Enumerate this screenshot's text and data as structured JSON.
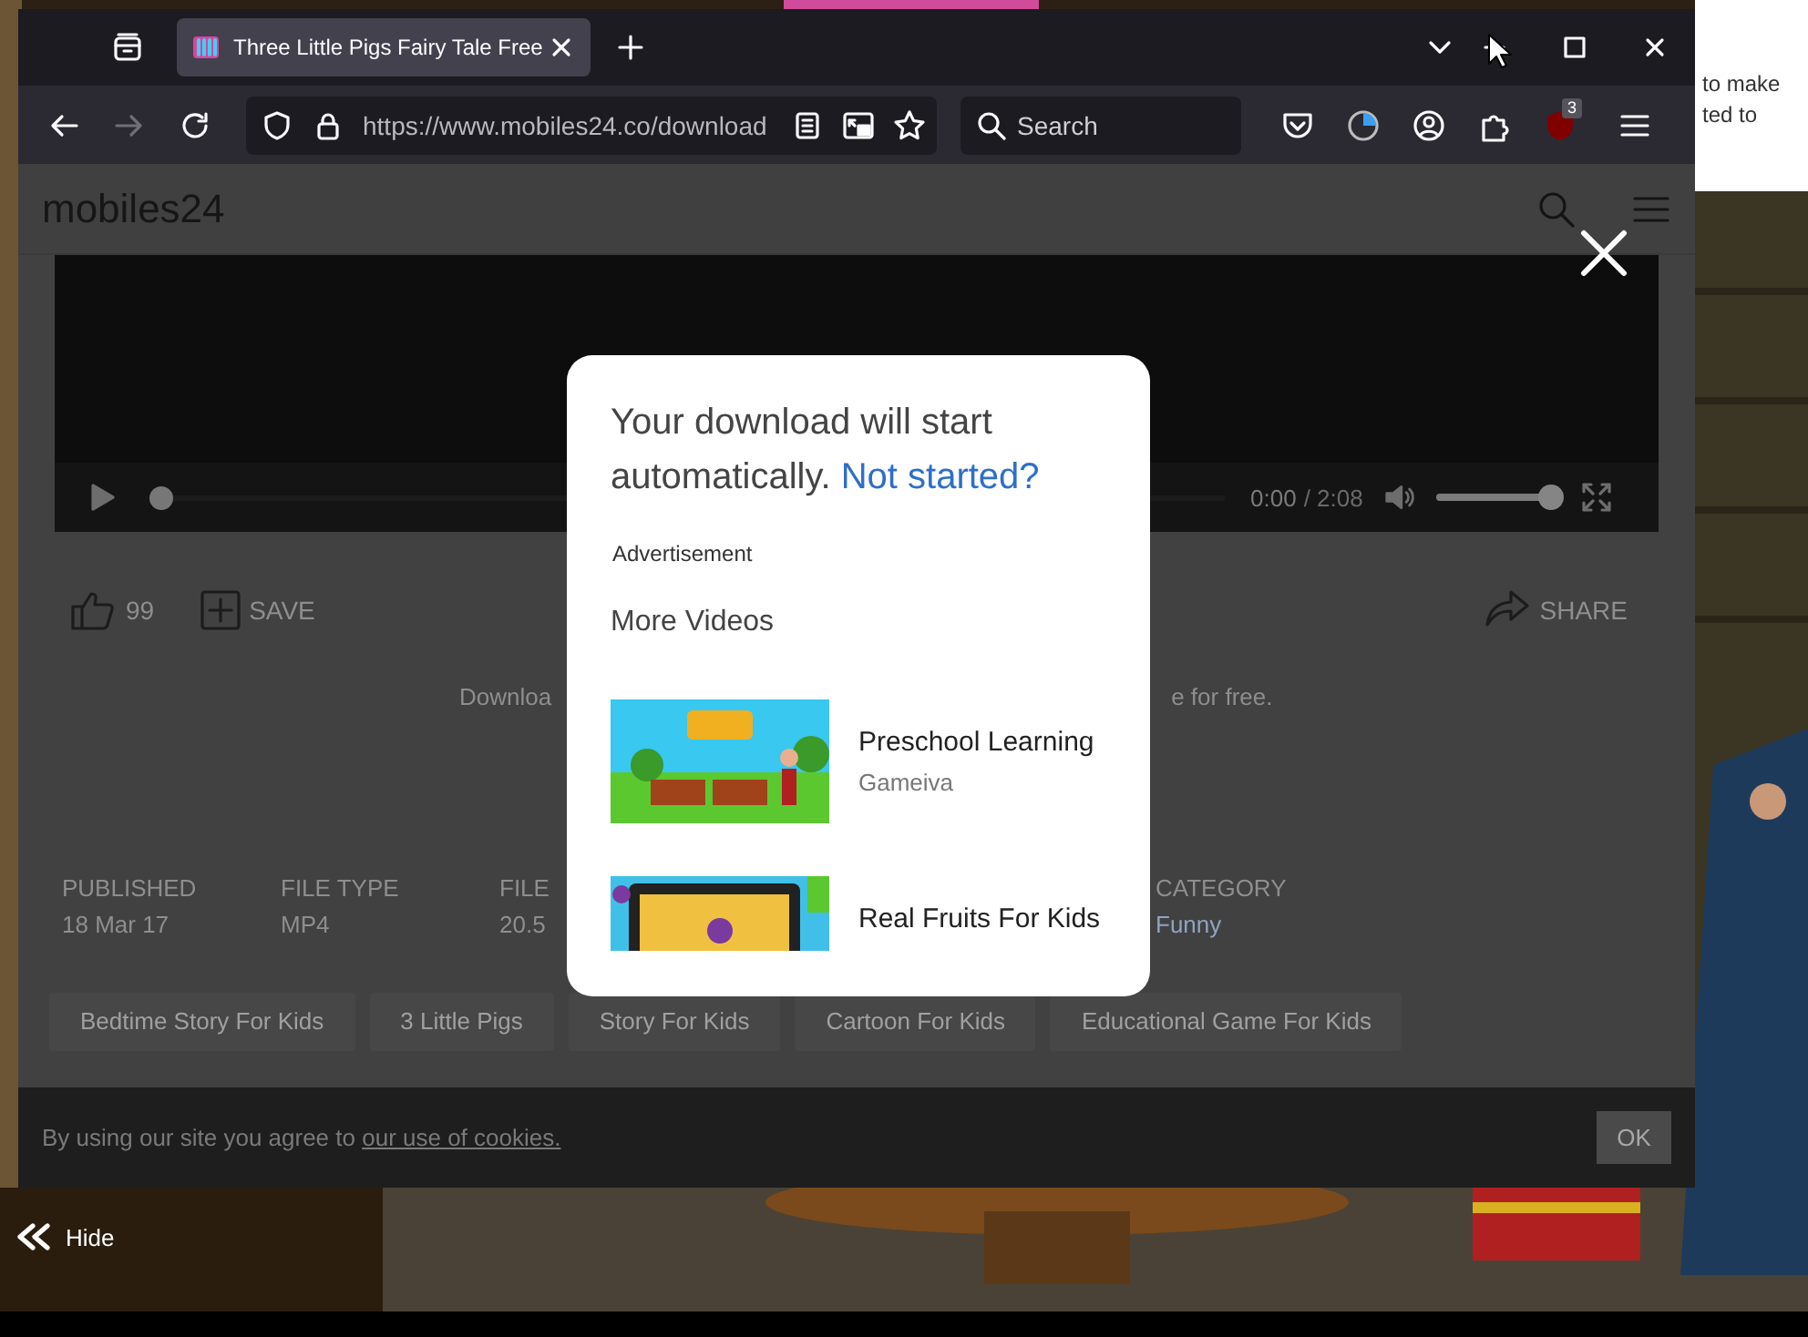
{
  "desktop": {
    "background": {
      "kind": "picture"
    },
    "side_window_lines": [
      "to make",
      "ted to"
    ],
    "hide_button": {
      "label": "Hide"
    }
  },
  "browser": {
    "tabs": [
      {
        "title": "Three Little Pigs Fairy Tale Free",
        "selected": true
      }
    ],
    "forward_disabled": true,
    "url": "https://www.mobiles24.co/download",
    "search": {
      "placeholder": "Search"
    },
    "extension_badge": "3"
  },
  "site": {
    "logo": "mobiles24",
    "player": {
      "time": "0:00",
      "duration": "/ 2:08",
      "progress": {
        "level": 0
      },
      "volume": {
        "level": 0.95
      }
    },
    "likes": "99",
    "save": "SAVE",
    "share": "SHARE",
    "download_text_left": "Downloa",
    "download_text_right": "e for free.",
    "meta_left": [
      {
        "label": "PUBLISHED",
        "value": "18 Mar 17"
      },
      {
        "label": "FILE TYPE",
        "value": "MP4"
      },
      {
        "label": "FILE",
        "value": "20.5"
      }
    ],
    "meta_right": [
      {
        "label": "CATEGORY",
        "value": "Funny"
      }
    ],
    "tags": [
      "Bedtime Story For Kids",
      "3 Little Pigs",
      "Story For Kids",
      "Cartoon For Kids",
      "Educational Game For Kids"
    ],
    "cookie": {
      "text": "By using our site you agree to ",
      "link": "our use of cookies.",
      "button": "OK"
    }
  },
  "modal": {
    "message": "Your download will start automatically. ",
    "link": "Not started?",
    "ad_label": "Advertisement",
    "section_title": "More Videos",
    "videos": [
      {
        "title": "Preschool Learning",
        "author": "Gameiva",
        "thumbnail": {
          "kind": "picture"
        }
      },
      {
        "title": "Real Fruits For Kids",
        "thumbnail": {
          "kind": "picture"
        }
      }
    ]
  }
}
